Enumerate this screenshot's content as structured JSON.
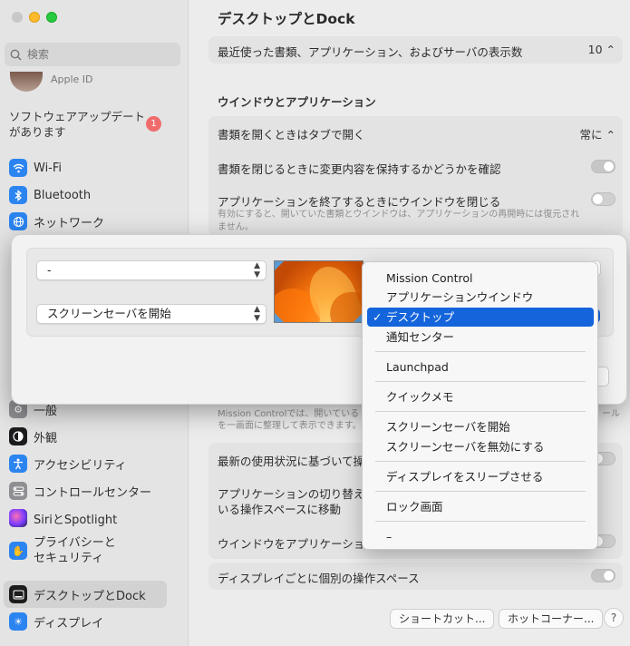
{
  "window": {
    "title": "デスクトップとDock"
  },
  "sidebar": {
    "search_placeholder": "検索",
    "apple_id": "Apple ID",
    "update_text": "ソフトウェアアップデートがあります",
    "update_badge": "1",
    "items": [
      {
        "label": "Wi-Fi",
        "icon": "wifi-icon",
        "color": "#2b84f0"
      },
      {
        "label": "Bluetooth",
        "icon": "bluetooth-icon",
        "color": "#2b84f0"
      },
      {
        "label": "ネットワーク",
        "icon": "globe-icon",
        "color": "#2b84f0"
      },
      {
        "label": "一般",
        "icon": "gear-icon",
        "color": "#8e8e93"
      },
      {
        "label": "外観",
        "icon": "appearance-icon",
        "color": "#1c1c1e"
      },
      {
        "label": "アクセシビリティ",
        "icon": "accessibility-icon",
        "color": "#2b84f0"
      },
      {
        "label": "コントロールセンター",
        "icon": "control-center-icon",
        "color": "#8e8e93"
      },
      {
        "label": "SiriとSpotlight",
        "icon": "siri-icon",
        "color": "#b44cdc"
      },
      {
        "label": "プライバシーと\nセキュリティ",
        "icon": "hand-icon",
        "color": "#2b84f0"
      },
      {
        "label": "デスクトップとDock",
        "icon": "dock-icon",
        "color": "#1c1c1e"
      },
      {
        "label": "ディスプレイ",
        "icon": "display-icon",
        "color": "#2b84f0"
      }
    ]
  },
  "main": {
    "recent_items_label": "最近使った書類、アプリケーション、およびサーバの表示数",
    "recent_items_value": "10",
    "section_windows": "ウインドウとアプリケーション",
    "tabs_label": "書類を開くときはタブで開く",
    "tabs_value": "常に",
    "ask_keep_changes": "書類を閉じるときに変更内容を保持するかどうかを確認",
    "close_windows_label": "アプリケーションを終了するときにウインドウを閉じる",
    "close_windows_note": "有効にすると、開いていた書類とウインドウは、アプリケーションの再開時には復元されません。",
    "mission_note": "Mission Controlでは、開いている",
    "mission_note_tail": "ール",
    "mission_note2": "を一画面に整理して表示できます。",
    "rearrange_label": "最新の使用状況に基づいて操作",
    "switch_label_1": "アプリケーションの切り替えで",
    "switch_label_2": "いる操作スペースに移動",
    "group_label": "ウインドウをアプリケーショ",
    "separate_spaces": "ディスプレイごとに個別の操作スペース",
    "shortcuts_button": "ショートカット...",
    "hot_corners_button": "ホットコーナー...",
    "help": "?"
  },
  "sheet": {
    "top_left_value": "-",
    "bottom_left_value": "スクリーンセーバを開始"
  },
  "menu": {
    "items": [
      "Mission Control",
      "アプリケーションウインドウ",
      "デスクトップ",
      "通知センター",
      "Launchpad",
      "クイックメモ",
      "スクリーンセーバを開始",
      "スクリーンセーバを無効にする",
      "ディスプレイをスリープさせる",
      "ロック画面",
      "–"
    ],
    "selected": "デスクトップ",
    "check": "✓"
  }
}
